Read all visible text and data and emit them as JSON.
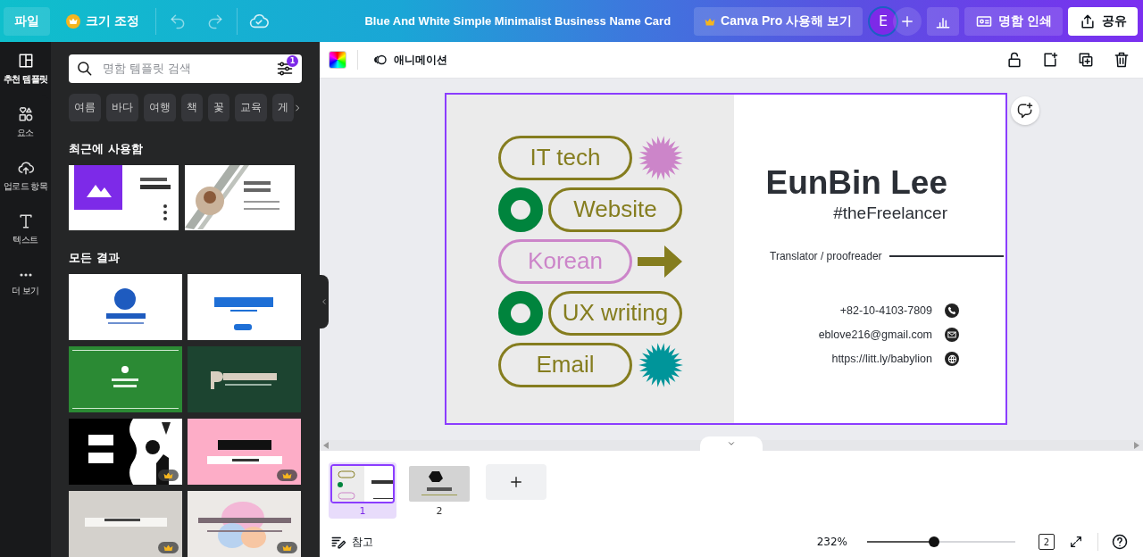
{
  "topbar": {
    "file_button": "파일",
    "resize_button": "크기 조정",
    "title": "Blue And White Simple Minimalist Business Name Card",
    "pro_button": "Canva Pro 사용해 보기",
    "avatar": "E",
    "print_button": "명함 인쇄",
    "share_button": "공유"
  },
  "rail": [
    {
      "label": "추천 템플릿",
      "kind": "templates",
      "selected": true
    },
    {
      "label": "요소",
      "kind": "elements",
      "selected": false
    },
    {
      "label": "업로드 항목",
      "kind": "uploads",
      "selected": false
    },
    {
      "label": "텍스트",
      "kind": "text",
      "selected": false
    },
    {
      "label": "더 보기",
      "kind": "more",
      "selected": false
    }
  ],
  "panel": {
    "search": {
      "placeholder": "명함 템플릿 검색",
      "filter_count": "1"
    },
    "chips": [
      "여름",
      "바다",
      "여행",
      "책",
      "꽃",
      "교육",
      "게"
    ],
    "recent_heading": "최근에 사용함",
    "recent": [
      {
        "kind": "picture"
      },
      {
        "kind": "picture"
      }
    ],
    "all_heading": "모든 결과",
    "results": [
      {
        "kind": "picture",
        "premium": false
      },
      {
        "kind": "picture",
        "premium": false
      },
      {
        "kind": "picture",
        "premium": false
      },
      {
        "kind": "picture",
        "premium": false
      },
      {
        "kind": "picture",
        "premium": true
      },
      {
        "kind": "picture",
        "premium": true
      },
      {
        "kind": "picture",
        "premium": true
      },
      {
        "kind": "picture",
        "premium": true
      }
    ]
  },
  "toolbar": {
    "animation_button": "애니메이션"
  },
  "card": {
    "tags": [
      {
        "label": "IT tech",
        "color": "#857d1f",
        "decor": {
          "kind": "burst",
          "color": "#cc85c9"
        }
      },
      {
        "label": "Website",
        "color": "#857d1f",
        "decor": {
          "kind": "ring",
          "color": "#00843d"
        }
      },
      {
        "label": "Korean",
        "color": "#cc85c9",
        "decor": {
          "kind": "arrow",
          "color": "#857d1f"
        }
      },
      {
        "label": "UX writing",
        "color": "#857d1f",
        "decor": {
          "kind": "ring",
          "color": "#00843d"
        }
      },
      {
        "label": "Email",
        "color": "#857d1f",
        "decor": {
          "kind": "burst",
          "color": "#00959a"
        }
      }
    ],
    "name": "EunBin Lee",
    "tagline": "#theFreelancer",
    "role": "Translator / proofreader",
    "contacts": [
      {
        "text": "+82-10-4103-7809",
        "kind": "phone"
      },
      {
        "text": "eblove216@gmail.com",
        "kind": "email"
      },
      {
        "text": "https://litt.ly/babylion",
        "kind": "web"
      }
    ]
  },
  "pages": [
    {
      "number": "1",
      "selected": true
    },
    {
      "number": "2",
      "selected": false
    }
  ],
  "footer": {
    "notes_button": "참고",
    "zoom": "232%",
    "zoom_slider": {
      "level": 0.45
    },
    "page_count": "2"
  }
}
